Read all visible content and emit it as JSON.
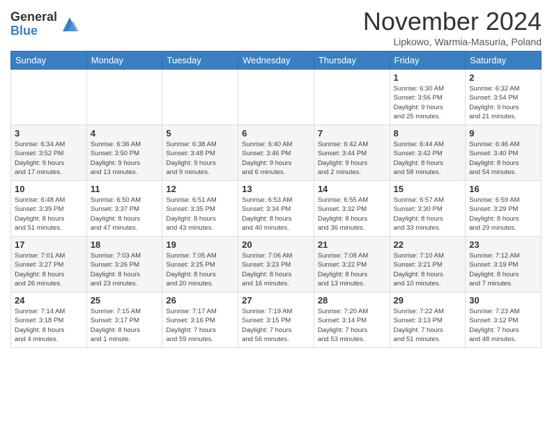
{
  "header": {
    "logo_general": "General",
    "logo_blue": "Blue",
    "month_title": "November 2024",
    "location": "Lipkowo, Warmia-Masuria, Poland"
  },
  "days_of_week": [
    "Sunday",
    "Monday",
    "Tuesday",
    "Wednesday",
    "Thursday",
    "Friday",
    "Saturday"
  ],
  "weeks": [
    [
      {
        "day": "",
        "info": ""
      },
      {
        "day": "",
        "info": ""
      },
      {
        "day": "",
        "info": ""
      },
      {
        "day": "",
        "info": ""
      },
      {
        "day": "",
        "info": ""
      },
      {
        "day": "1",
        "info": "Sunrise: 6:30 AM\nSunset: 3:56 PM\nDaylight: 9 hours\nand 25 minutes."
      },
      {
        "day": "2",
        "info": "Sunrise: 6:32 AM\nSunset: 3:54 PM\nDaylight: 9 hours\nand 21 minutes."
      }
    ],
    [
      {
        "day": "3",
        "info": "Sunrise: 6:34 AM\nSunset: 3:52 PM\nDaylight: 9 hours\nand 17 minutes."
      },
      {
        "day": "4",
        "info": "Sunrise: 6:36 AM\nSunset: 3:50 PM\nDaylight: 9 hours\nand 13 minutes."
      },
      {
        "day": "5",
        "info": "Sunrise: 6:38 AM\nSunset: 3:48 PM\nDaylight: 9 hours\nand 9 minutes."
      },
      {
        "day": "6",
        "info": "Sunrise: 6:40 AM\nSunset: 3:46 PM\nDaylight: 9 hours\nand 6 minutes."
      },
      {
        "day": "7",
        "info": "Sunrise: 6:42 AM\nSunset: 3:44 PM\nDaylight: 9 hours\nand 2 minutes."
      },
      {
        "day": "8",
        "info": "Sunrise: 6:44 AM\nSunset: 3:42 PM\nDaylight: 8 hours\nand 58 minutes."
      },
      {
        "day": "9",
        "info": "Sunrise: 6:46 AM\nSunset: 3:40 PM\nDaylight: 8 hours\nand 54 minutes."
      }
    ],
    [
      {
        "day": "10",
        "info": "Sunrise: 6:48 AM\nSunset: 3:39 PM\nDaylight: 8 hours\nand 51 minutes."
      },
      {
        "day": "11",
        "info": "Sunrise: 6:50 AM\nSunset: 3:37 PM\nDaylight: 8 hours\nand 47 minutes."
      },
      {
        "day": "12",
        "info": "Sunrise: 6:51 AM\nSunset: 3:35 PM\nDaylight: 8 hours\nand 43 minutes."
      },
      {
        "day": "13",
        "info": "Sunrise: 6:53 AM\nSunset: 3:34 PM\nDaylight: 8 hours\nand 40 minutes."
      },
      {
        "day": "14",
        "info": "Sunrise: 6:55 AM\nSunset: 3:32 PM\nDaylight: 8 hours\nand 36 minutes."
      },
      {
        "day": "15",
        "info": "Sunrise: 6:57 AM\nSunset: 3:30 PM\nDaylight: 8 hours\nand 33 minutes."
      },
      {
        "day": "16",
        "info": "Sunrise: 6:59 AM\nSunset: 3:29 PM\nDaylight: 8 hours\nand 29 minutes."
      }
    ],
    [
      {
        "day": "17",
        "info": "Sunrise: 7:01 AM\nSunset: 3:27 PM\nDaylight: 8 hours\nand 26 minutes."
      },
      {
        "day": "18",
        "info": "Sunrise: 7:03 AM\nSunset: 3:26 PM\nDaylight: 8 hours\nand 23 minutes."
      },
      {
        "day": "19",
        "info": "Sunrise: 7:05 AM\nSunset: 3:25 PM\nDaylight: 8 hours\nand 20 minutes."
      },
      {
        "day": "20",
        "info": "Sunrise: 7:06 AM\nSunset: 3:23 PM\nDaylight: 8 hours\nand 16 minutes."
      },
      {
        "day": "21",
        "info": "Sunrise: 7:08 AM\nSunset: 3:22 PM\nDaylight: 8 hours\nand 13 minutes."
      },
      {
        "day": "22",
        "info": "Sunrise: 7:10 AM\nSunset: 3:21 PM\nDaylight: 8 hours\nand 10 minutes."
      },
      {
        "day": "23",
        "info": "Sunrise: 7:12 AM\nSunset: 3:19 PM\nDaylight: 8 hours\nand 7 minutes."
      }
    ],
    [
      {
        "day": "24",
        "info": "Sunrise: 7:14 AM\nSunset: 3:18 PM\nDaylight: 8 hours\nand 4 minutes."
      },
      {
        "day": "25",
        "info": "Sunrise: 7:15 AM\nSunset: 3:17 PM\nDaylight: 8 hours\nand 1 minute."
      },
      {
        "day": "26",
        "info": "Sunrise: 7:17 AM\nSunset: 3:16 PM\nDaylight: 7 hours\nand 59 minutes."
      },
      {
        "day": "27",
        "info": "Sunrise: 7:19 AM\nSunset: 3:15 PM\nDaylight: 7 hours\nand 56 minutes."
      },
      {
        "day": "28",
        "info": "Sunrise: 7:20 AM\nSunset: 3:14 PM\nDaylight: 7 hours\nand 53 minutes."
      },
      {
        "day": "29",
        "info": "Sunrise: 7:22 AM\nSunset: 3:13 PM\nDaylight: 7 hours\nand 51 minutes."
      },
      {
        "day": "30",
        "info": "Sunrise: 7:23 AM\nSunset: 3:12 PM\nDaylight: 7 hours\nand 48 minutes."
      }
    ]
  ]
}
